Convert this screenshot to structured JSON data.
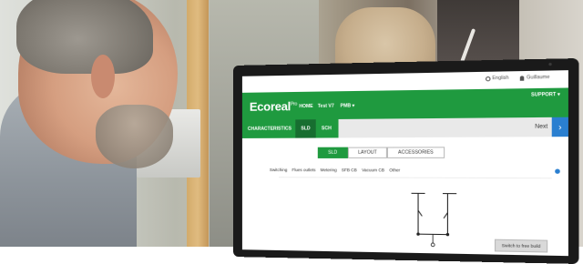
{
  "app": {
    "logo": "Ecoreal",
    "logo_sup": "Pro",
    "top_bar": {
      "language": "English",
      "user": "Guillaume"
    },
    "nav": {
      "home": "HOME",
      "project": "Test V7",
      "pmb": "PMB ▾",
      "support": "SUPPORT ▾"
    },
    "steps": [
      "CHARACTERISTICS",
      "SLD",
      "SCH"
    ],
    "next_label": "Next",
    "next_icon": "›",
    "tabs": [
      "SLD",
      "LAYOUT",
      "ACCESSORIES"
    ],
    "submenu": [
      "Switching",
      "Flues outlets",
      "Metering",
      "SFB CB",
      "Vacuum CB",
      "Other"
    ],
    "switch_button": "Switch to free build"
  },
  "colors": {
    "brand_green": "#1f9a3f",
    "dark_green": "#176e30",
    "accent_blue": "#2a7fd0"
  }
}
